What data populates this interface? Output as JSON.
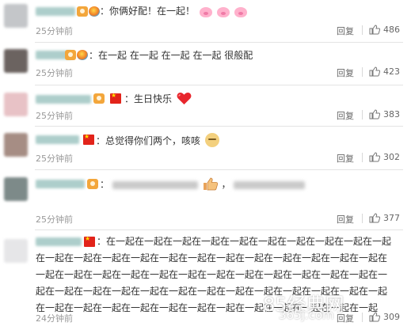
{
  "comments": [
    {
      "text": "：你俩好配！在一起！",
      "emoji": "pig-face-emoji x3",
      "time": "25分钟前",
      "reply": "回复",
      "likes": "486"
    },
    {
      "text": "：在一起 在一起 在一起 在一起 很般配",
      "time": "25分钟前",
      "reply": "回复",
      "likes": "423"
    },
    {
      "text": "：生日快乐",
      "emoji": "red-heart-emoji",
      "time": "25分钟前",
      "reply": "回复",
      "likes": "383"
    },
    {
      "text": "：总觉得你们两个，咳咳",
      "emoji": "doge-emoji",
      "time": "25分钟前",
      "reply": "回复",
      "likes": "302"
    },
    {
      "text": "：",
      "emoji": "thumbs-up-emoji",
      "time": "25分钟前",
      "reply": "回复",
      "likes": "377"
    },
    {
      "text": "：在一起在一起在一起在一起在一起在一起在一起在一起在一起在一起在一起在一起在一起在一起在一起在一起在一起在一起在一起在一起在一起在一起在一起在一起在一起在一起在一起在一起在一起在一起在一起在一起在一起在一起在一起在一起在一起在一起在一起在一起在一起在一起在一起在一起在一起在一起在一起在一起在一起在一起在一起在一起在一起在一起在一起在一起在一起在一起在一起",
      "time": "24分钟前",
      "reply": "回复",
      "likes": "309"
    }
  ],
  "watermark": {
    "main": "85经典网",
    "sub": "365j.com"
  },
  "colors": {
    "text": "#333333",
    "meta": "#999999",
    "action": "#666666",
    "divider": "#e4e4e4"
  }
}
